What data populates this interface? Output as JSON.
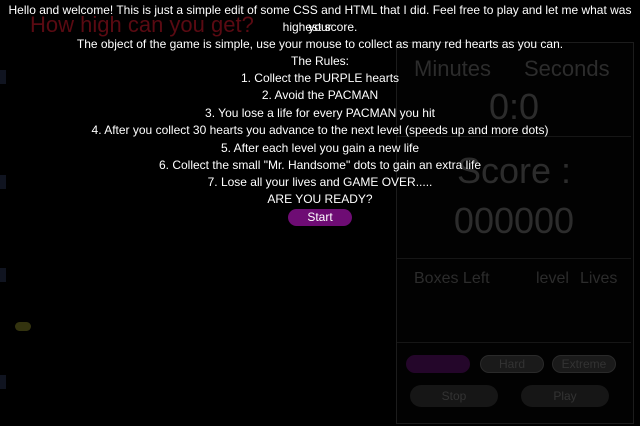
{
  "game": {
    "title": "How high can you get?",
    "panel": {
      "minutes_label": "Minutes",
      "seconds_label": "Seconds",
      "timer": "0:0",
      "score_label": "Score :",
      "score": "000000",
      "boxes_left_label": "Boxes Left",
      "level_label": "level",
      "lives_label": "Lives",
      "difficulty": [
        "",
        "Hard",
        "Extreme"
      ],
      "stop_label": "Stop",
      "play_label": "Play"
    }
  },
  "intro": {
    "lines": [
      "Hello and welcome! This is just a simple edit of some CSS and HTML that I did. Feel free to play and let me what was your",
      "highest score.",
      "The object of the game is simple, use your mouse to collect as many red hearts as you can.",
      "The Rules:",
      "1. Collect the PURPLE hearts",
      "2. Avoid the PACMAN",
      "3. You lose a life for every PACMAN you hit",
      "4. After you collect 30 hearts you advance to the next level (speeds up and more dots)",
      "5. After each level you gain a new life",
      "6. Collect the small \"Mr. Handsome\" dots to gain an extra life",
      "7. Lose all your lives and GAME OVER.....",
      "ARE YOU READY?"
    ],
    "start_label": "Start"
  },
  "colors": {
    "background": "#000000",
    "accent": "#6e0c74",
    "title_dim": "#5a0a12"
  }
}
